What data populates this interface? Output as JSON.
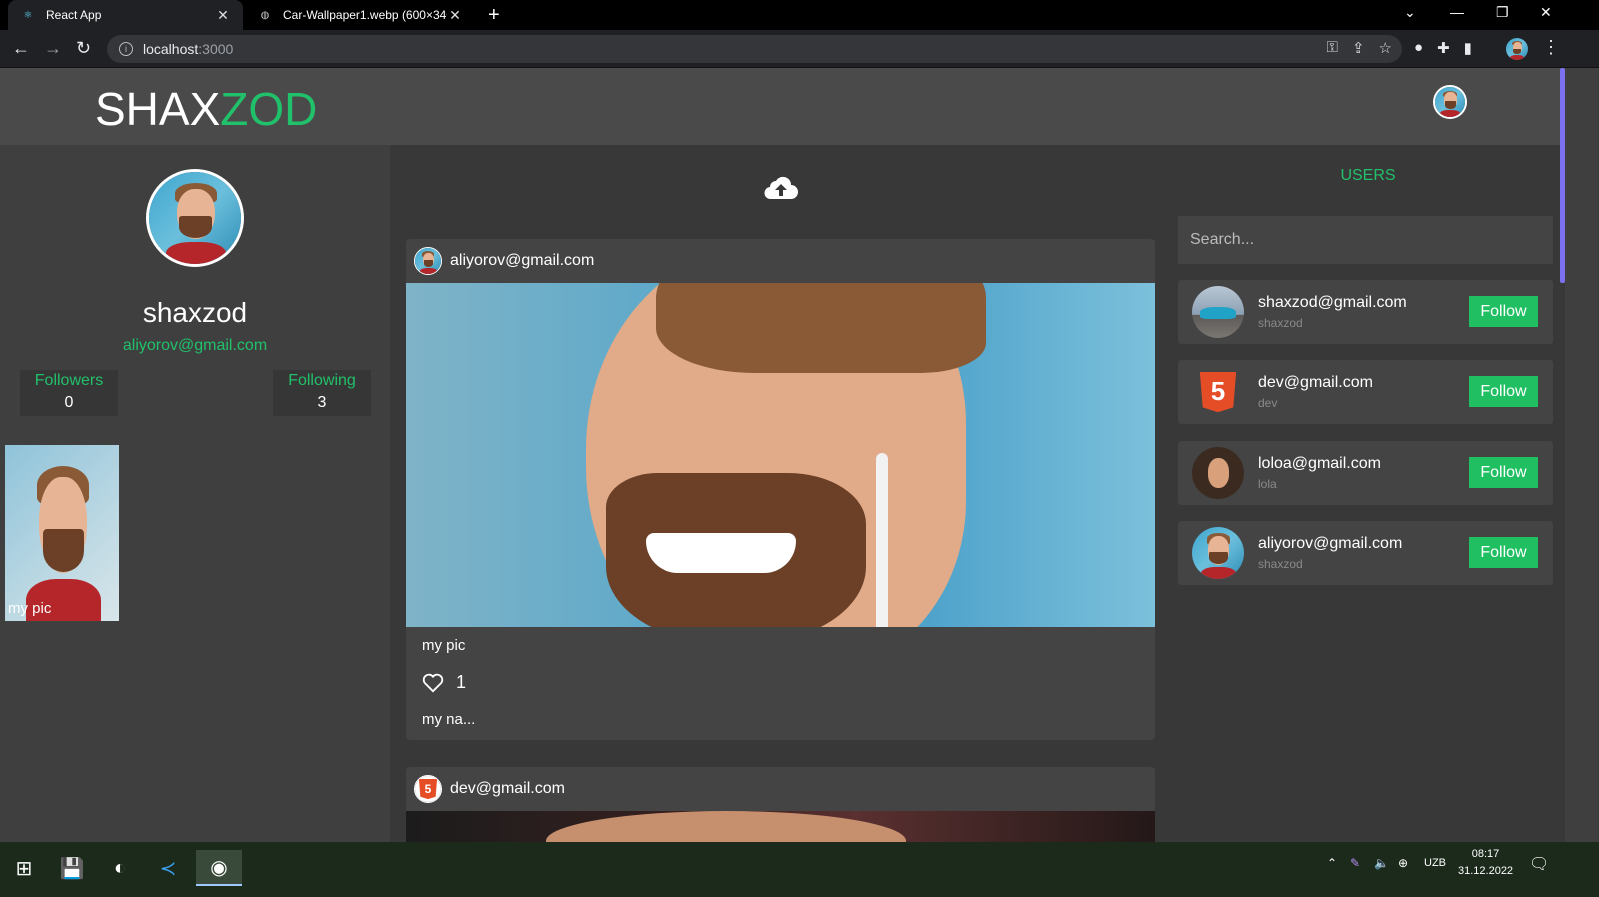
{
  "browser": {
    "tabs": [
      {
        "title": "React App",
        "active": true
      },
      {
        "title": "Car-Wallpaper1.webp (600×340)",
        "active": false
      }
    ],
    "address": {
      "host": "localhost",
      "port": ":3000"
    }
  },
  "header": {
    "logo_primary": "SHAX",
    "logo_accent": "ZOD"
  },
  "profile": {
    "username": "shaxzod",
    "email": "aliyorov@gmail.com",
    "followers_label": "Followers",
    "followers_count": "0",
    "following_label": "Following",
    "following_count": "3",
    "posts": [
      {
        "caption": "my pic"
      }
    ]
  },
  "feed": {
    "posts": [
      {
        "author": "aliyorov@gmail.com",
        "caption": "my pic",
        "likes": "1",
        "text": "my na..."
      },
      {
        "author": "dev@gmail.com"
      }
    ]
  },
  "users_panel": {
    "title": "USERS",
    "search_placeholder": "Search...",
    "users": [
      {
        "email": "shaxzod@gmail.com",
        "name": "shaxzod",
        "button": "Follow",
        "avatar": "car-photo"
      },
      {
        "email": "dev@gmail.com",
        "name": "dev",
        "button": "Follow",
        "avatar": "html5-logo"
      },
      {
        "email": "loloa@gmail.com",
        "name": "lola",
        "button": "Follow",
        "avatar": "woman-photo"
      },
      {
        "email": "aliyorov@gmail.com",
        "name": "shaxzod",
        "button": "Follow",
        "avatar": "man-photo"
      }
    ]
  },
  "taskbar": {
    "language": "UZB",
    "time": "08:17",
    "date": "31.12.2022"
  },
  "colors": {
    "accent": "#21c06a",
    "follow_button": "#1fbf62",
    "background": "#3f3f3f",
    "panel": "#383838",
    "card": "#444444"
  }
}
